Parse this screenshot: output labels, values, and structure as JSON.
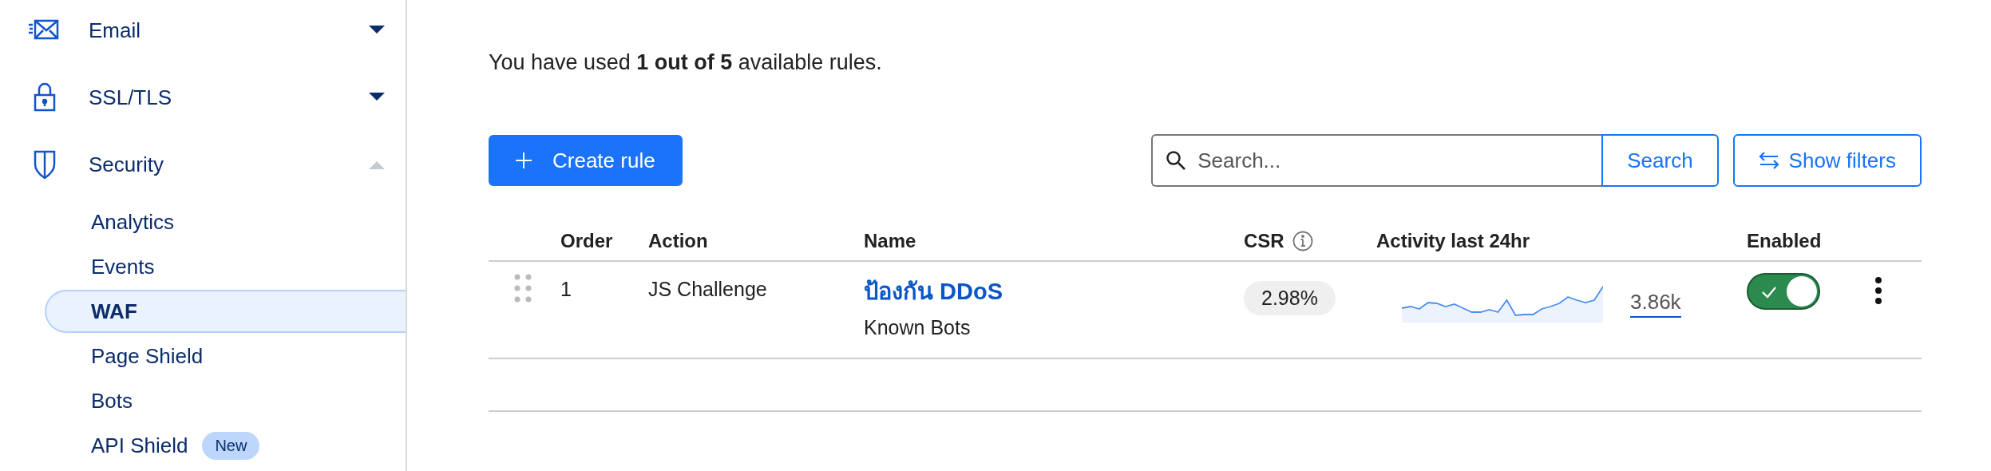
{
  "sidebar": {
    "items": [
      {
        "label": "Email",
        "expanded": false
      },
      {
        "label": "SSL/TLS",
        "expanded": false
      },
      {
        "label": "Security",
        "expanded": true,
        "children": [
          {
            "label": "Analytics",
            "selected": false
          },
          {
            "label": "Events",
            "selected": false
          },
          {
            "label": "WAF",
            "selected": true
          },
          {
            "label": "Page Shield",
            "selected": false
          },
          {
            "label": "Bots",
            "selected": false
          },
          {
            "label": "API Shield",
            "selected": false,
            "badge": "New"
          }
        ]
      }
    ]
  },
  "usage": "You have used **1 out of 5** available rules.",
  "toolbar": {
    "create_button": "Create rule",
    "search": {
      "placeholder": "Search...",
      "button": "Search"
    },
    "filters_button": "Show filters"
  },
  "table": {
    "columns": [
      "Order",
      "Action",
      "Name",
      "CSR",
      "Activity last 24hr",
      "Enabled"
    ],
    "rows": [
      {
        "order": "1",
        "action": "JS Challenge",
        "name": "ป้องกัน DDoS",
        "description": "Known Bots",
        "csr": "2.98%",
        "activity_total": "3.86k",
        "enabled": true
      }
    ]
  }
}
